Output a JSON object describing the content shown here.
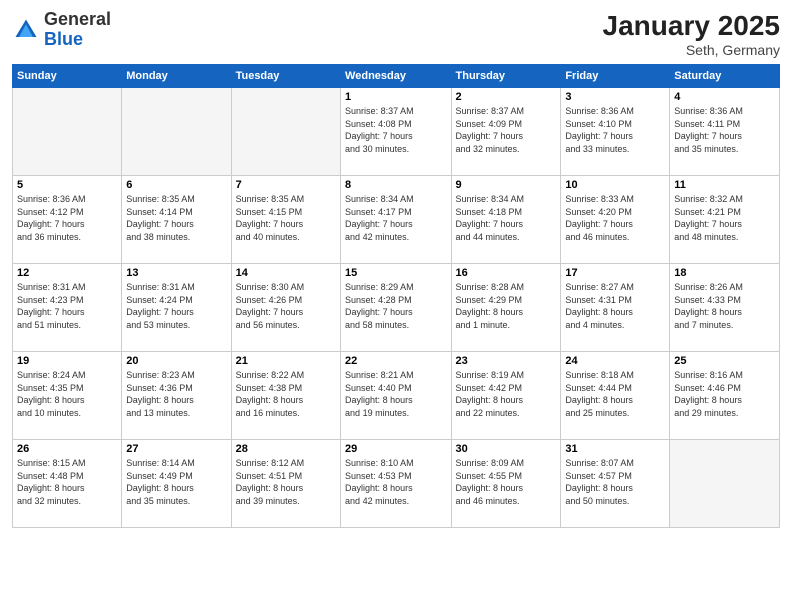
{
  "header": {
    "logo_general": "General",
    "logo_blue": "Blue",
    "month_title": "January 2025",
    "location": "Seth, Germany"
  },
  "days_of_week": [
    "Sunday",
    "Monday",
    "Tuesday",
    "Wednesday",
    "Thursday",
    "Friday",
    "Saturday"
  ],
  "weeks": [
    [
      {
        "day": "",
        "info": ""
      },
      {
        "day": "",
        "info": ""
      },
      {
        "day": "",
        "info": ""
      },
      {
        "day": "1",
        "info": "Sunrise: 8:37 AM\nSunset: 4:08 PM\nDaylight: 7 hours\nand 30 minutes."
      },
      {
        "day": "2",
        "info": "Sunrise: 8:37 AM\nSunset: 4:09 PM\nDaylight: 7 hours\nand 32 minutes."
      },
      {
        "day": "3",
        "info": "Sunrise: 8:36 AM\nSunset: 4:10 PM\nDaylight: 7 hours\nand 33 minutes."
      },
      {
        "day": "4",
        "info": "Sunrise: 8:36 AM\nSunset: 4:11 PM\nDaylight: 7 hours\nand 35 minutes."
      }
    ],
    [
      {
        "day": "5",
        "info": "Sunrise: 8:36 AM\nSunset: 4:12 PM\nDaylight: 7 hours\nand 36 minutes."
      },
      {
        "day": "6",
        "info": "Sunrise: 8:35 AM\nSunset: 4:14 PM\nDaylight: 7 hours\nand 38 minutes."
      },
      {
        "day": "7",
        "info": "Sunrise: 8:35 AM\nSunset: 4:15 PM\nDaylight: 7 hours\nand 40 minutes."
      },
      {
        "day": "8",
        "info": "Sunrise: 8:34 AM\nSunset: 4:17 PM\nDaylight: 7 hours\nand 42 minutes."
      },
      {
        "day": "9",
        "info": "Sunrise: 8:34 AM\nSunset: 4:18 PM\nDaylight: 7 hours\nand 44 minutes."
      },
      {
        "day": "10",
        "info": "Sunrise: 8:33 AM\nSunset: 4:20 PM\nDaylight: 7 hours\nand 46 minutes."
      },
      {
        "day": "11",
        "info": "Sunrise: 8:32 AM\nSunset: 4:21 PM\nDaylight: 7 hours\nand 48 minutes."
      }
    ],
    [
      {
        "day": "12",
        "info": "Sunrise: 8:31 AM\nSunset: 4:23 PM\nDaylight: 7 hours\nand 51 minutes."
      },
      {
        "day": "13",
        "info": "Sunrise: 8:31 AM\nSunset: 4:24 PM\nDaylight: 7 hours\nand 53 minutes."
      },
      {
        "day": "14",
        "info": "Sunrise: 8:30 AM\nSunset: 4:26 PM\nDaylight: 7 hours\nand 56 minutes."
      },
      {
        "day": "15",
        "info": "Sunrise: 8:29 AM\nSunset: 4:28 PM\nDaylight: 7 hours\nand 58 minutes."
      },
      {
        "day": "16",
        "info": "Sunrise: 8:28 AM\nSunset: 4:29 PM\nDaylight: 8 hours\nand 1 minute."
      },
      {
        "day": "17",
        "info": "Sunrise: 8:27 AM\nSunset: 4:31 PM\nDaylight: 8 hours\nand 4 minutes."
      },
      {
        "day": "18",
        "info": "Sunrise: 8:26 AM\nSunset: 4:33 PM\nDaylight: 8 hours\nand 7 minutes."
      }
    ],
    [
      {
        "day": "19",
        "info": "Sunrise: 8:24 AM\nSunset: 4:35 PM\nDaylight: 8 hours\nand 10 minutes."
      },
      {
        "day": "20",
        "info": "Sunrise: 8:23 AM\nSunset: 4:36 PM\nDaylight: 8 hours\nand 13 minutes."
      },
      {
        "day": "21",
        "info": "Sunrise: 8:22 AM\nSunset: 4:38 PM\nDaylight: 8 hours\nand 16 minutes."
      },
      {
        "day": "22",
        "info": "Sunrise: 8:21 AM\nSunset: 4:40 PM\nDaylight: 8 hours\nand 19 minutes."
      },
      {
        "day": "23",
        "info": "Sunrise: 8:19 AM\nSunset: 4:42 PM\nDaylight: 8 hours\nand 22 minutes."
      },
      {
        "day": "24",
        "info": "Sunrise: 8:18 AM\nSunset: 4:44 PM\nDaylight: 8 hours\nand 25 minutes."
      },
      {
        "day": "25",
        "info": "Sunrise: 8:16 AM\nSunset: 4:46 PM\nDaylight: 8 hours\nand 29 minutes."
      }
    ],
    [
      {
        "day": "26",
        "info": "Sunrise: 8:15 AM\nSunset: 4:48 PM\nDaylight: 8 hours\nand 32 minutes."
      },
      {
        "day": "27",
        "info": "Sunrise: 8:14 AM\nSunset: 4:49 PM\nDaylight: 8 hours\nand 35 minutes."
      },
      {
        "day": "28",
        "info": "Sunrise: 8:12 AM\nSunset: 4:51 PM\nDaylight: 8 hours\nand 39 minutes."
      },
      {
        "day": "29",
        "info": "Sunrise: 8:10 AM\nSunset: 4:53 PM\nDaylight: 8 hours\nand 42 minutes."
      },
      {
        "day": "30",
        "info": "Sunrise: 8:09 AM\nSunset: 4:55 PM\nDaylight: 8 hours\nand 46 minutes."
      },
      {
        "day": "31",
        "info": "Sunrise: 8:07 AM\nSunset: 4:57 PM\nDaylight: 8 hours\nand 50 minutes."
      },
      {
        "day": "",
        "info": ""
      }
    ]
  ]
}
